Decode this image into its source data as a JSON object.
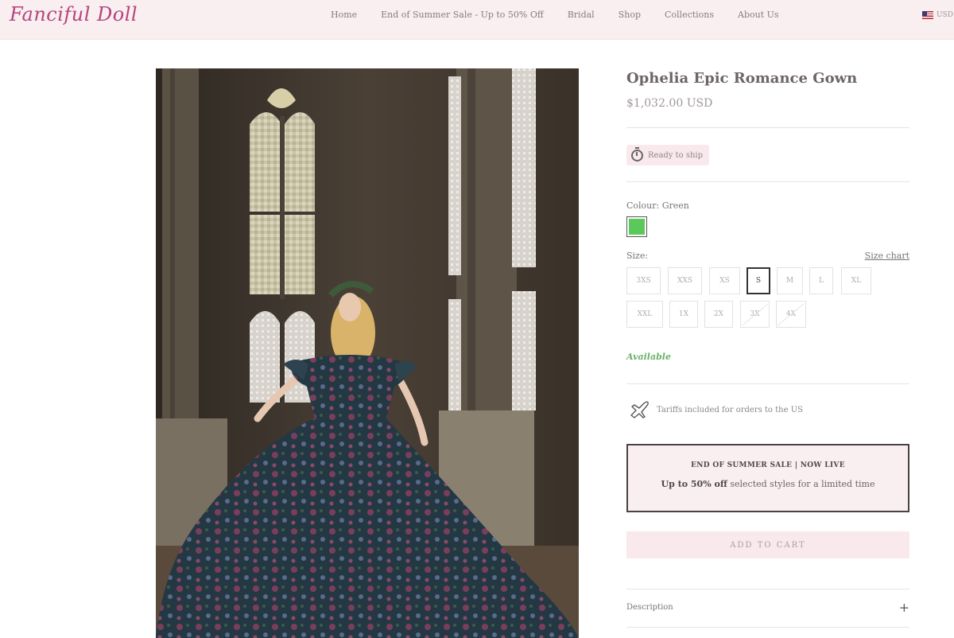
{
  "header": {
    "logo": "Fanciful Doll",
    "nav": [
      "Home",
      "End of Summer Sale - Up to 50% Off",
      "Bridal",
      "Shop",
      "Collections",
      "About Us"
    ],
    "locale": "USD"
  },
  "product": {
    "title": "Ophelia Epic Romance Gown",
    "price": "$1,032.00 USD",
    "ready_badge": "Ready to ship",
    "colour_label": "Colour: Green",
    "colour_value": "#5ac85a",
    "size_label": "Size:",
    "size_chart_link": "Size chart",
    "sizes": [
      "3XS",
      "XXS",
      "XS",
      "S",
      "M",
      "L",
      "XL",
      "XXL",
      "1X",
      "2X",
      "3X",
      "4X"
    ],
    "selected_size": "S",
    "unavailable_sizes": [
      "3X",
      "4X"
    ],
    "availability": "Available",
    "tariff_note": "Tariffs included for orders to the US",
    "promo": {
      "title": "END OF SUMMER SALE | NOW LIVE",
      "bold": "Up to 50% off",
      "text": " selected styles for a limited time"
    },
    "add_to_cart": "ADD TO CART",
    "description_label": "Description",
    "description_toggle": "+"
  }
}
